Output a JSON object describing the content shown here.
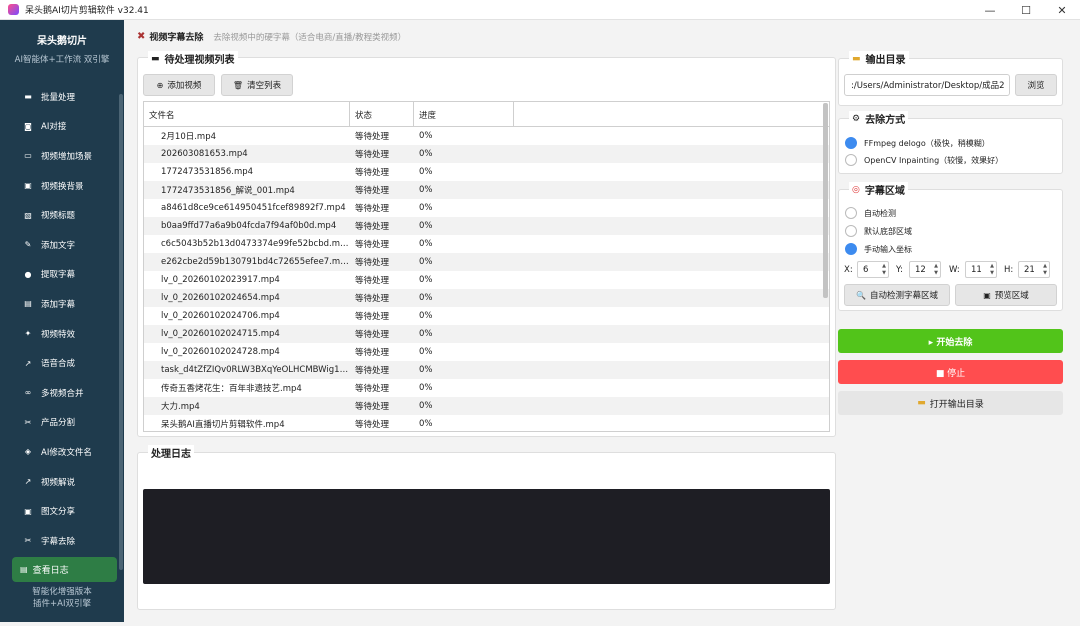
{
  "window": {
    "title": "呆头鹅AI切片剪辑软件 v32.41",
    "controls": [
      "—",
      "☐",
      "✕"
    ]
  },
  "sidebar": {
    "brand_title": "呆头鹅切片",
    "brand_sub": "AI智能体+工作流 双引擎",
    "items": [
      {
        "label": "批量处理",
        "icon": "folder-icon",
        "glyph": "▬"
      },
      {
        "label": "AI对接",
        "icon": "robot-icon",
        "glyph": "◙"
      },
      {
        "label": "视频增加场景",
        "icon": "keyboard-icon",
        "glyph": "▭"
      },
      {
        "label": "视频换背景",
        "icon": "image-icon",
        "glyph": "▣"
      },
      {
        "label": "视频标题",
        "icon": "film-icon",
        "glyph": "▧"
      },
      {
        "label": "添加文字",
        "icon": "pencil-icon",
        "glyph": "✎"
      },
      {
        "label": "提取字幕",
        "icon": "pin-icon",
        "glyph": "●"
      },
      {
        "label": "添加字幕",
        "icon": "document-icon",
        "glyph": "▤"
      },
      {
        "label": "视频特效",
        "icon": "sparkle-icon",
        "glyph": "✦"
      },
      {
        "label": "语音合成",
        "icon": "microphone-icon",
        "glyph": "↗"
      },
      {
        "label": "多视频合并",
        "icon": "link-icon",
        "glyph": "∞"
      },
      {
        "label": "产品分割",
        "icon": "scissors-icon",
        "glyph": "✂"
      },
      {
        "label": "AI修改文件名",
        "icon": "tag-icon",
        "glyph": "◈"
      },
      {
        "label": "视频解说",
        "icon": "microphone-icon",
        "glyph": "↗"
      },
      {
        "label": "图文分享",
        "icon": "gallery-icon",
        "glyph": "▣"
      },
      {
        "label": "字幕去除",
        "icon": "scissors-icon",
        "glyph": "✂"
      }
    ],
    "log_button": {
      "label": "查看日志",
      "icon": "clipboard-icon",
      "glyph": "▤"
    },
    "footer_line1": "智能化增强版本",
    "footer_line2": "插件+AI双引擎"
  },
  "header": {
    "title": "视频字幕去除",
    "description": "去除视频中的硬字幕（适合电商/直播/教程类视频）",
    "icon": "tools-icon"
  },
  "pending": {
    "title": "待处理视频列表",
    "title_icon": "folder-icon",
    "add_button": "添加视频",
    "clear_button": "清空列表",
    "columns": [
      "文件名",
      "状态",
      "进度"
    ],
    "rows": [
      {
        "name": "2月10日.mp4",
        "status": "等待处理",
        "progress": "0%"
      },
      {
        "name": "202603081653.mp4",
        "status": "等待处理",
        "progress": "0%"
      },
      {
        "name": "1772473531856.mp4",
        "status": "等待处理",
        "progress": "0%"
      },
      {
        "name": "1772473531856_解说_001.mp4",
        "status": "等待处理",
        "progress": "0%"
      },
      {
        "name": "a8461d8ce9ce614950451fcef89892f7.mp4",
        "status": "等待处理",
        "progress": "0%"
      },
      {
        "name": "b0aa9ffd77a6a9b04fcda7f94af0b0d.mp4",
        "status": "等待处理",
        "progress": "0%"
      },
      {
        "name": "c6c5043b52b13d0473374e99fe52bcbd.mp4",
        "status": "等待处理",
        "progress": "0%"
      },
      {
        "name": "e262cbe2d59b130791bd4c72655efee7.mp4",
        "status": "等待处理",
        "progress": "0%"
      },
      {
        "name": "lv_0_20260102023917.mp4",
        "status": "等待处理",
        "progress": "0%"
      },
      {
        "name": "lv_0_20260102024654.mp4",
        "status": "等待处理",
        "progress": "0%"
      },
      {
        "name": "lv_0_20260102024706.mp4",
        "status": "等待处理",
        "progress": "0%"
      },
      {
        "name": "lv_0_20260102024715.mp4",
        "status": "等待处理",
        "progress": "0%"
      },
      {
        "name": "lv_0_20260102024728.mp4",
        "status": "等待处理",
        "progress": "0%"
      },
      {
        "name": "task_d4tZfZIQv0RLW3BXqYeOLHCMBWig1D...",
        "status": "等待处理",
        "progress": "0%"
      },
      {
        "name": "传奇五香烤花生：百年非遗技艺.mp4",
        "status": "等待处理",
        "progress": "0%"
      },
      {
        "name": "大力.mp4",
        "status": "等待处理",
        "progress": "0%"
      },
      {
        "name": "呆头鹅AI直播切片剪辑软件.mp4",
        "status": "等待处理",
        "progress": "0%"
      }
    ]
  },
  "log": {
    "title": "处理日志"
  },
  "output": {
    "title": "输出目录",
    "path": ":/Users/Administrator/Desktop/成品2",
    "browse_button": "浏览"
  },
  "method": {
    "title": "去除方式",
    "options": [
      {
        "label": "FFmpeg delogo（极快，稍模糊）",
        "selected": true
      },
      {
        "label": "OpenCV Inpainting（较慢，效果好）",
        "selected": false
      }
    ]
  },
  "region": {
    "title": "字幕区域",
    "options": [
      {
        "label": "自动检测",
        "selected": false
      },
      {
        "label": "默认底部区域",
        "selected": false
      },
      {
        "label": "手动输入坐标",
        "selected": true
      }
    ],
    "coords": [
      {
        "label": "X:",
        "value": "6"
      },
      {
        "label": "Y:",
        "value": "12"
      },
      {
        "label": "W:",
        "value": "11"
      },
      {
        "label": "H:",
        "value": "21"
      }
    ],
    "detect_button": "自动检测字幕区域",
    "preview_button": "预览区域"
  },
  "actions": {
    "start": "▸ 开始去除",
    "stop": "■ 停止",
    "open_output": "打开输出目录"
  },
  "colors": {
    "sidebar": "#1f3b4d",
    "start": "#52c41a",
    "stop": "#ff4d4f",
    "radio_on": "#3d8bef",
    "log_bg": "#1e1e24"
  }
}
